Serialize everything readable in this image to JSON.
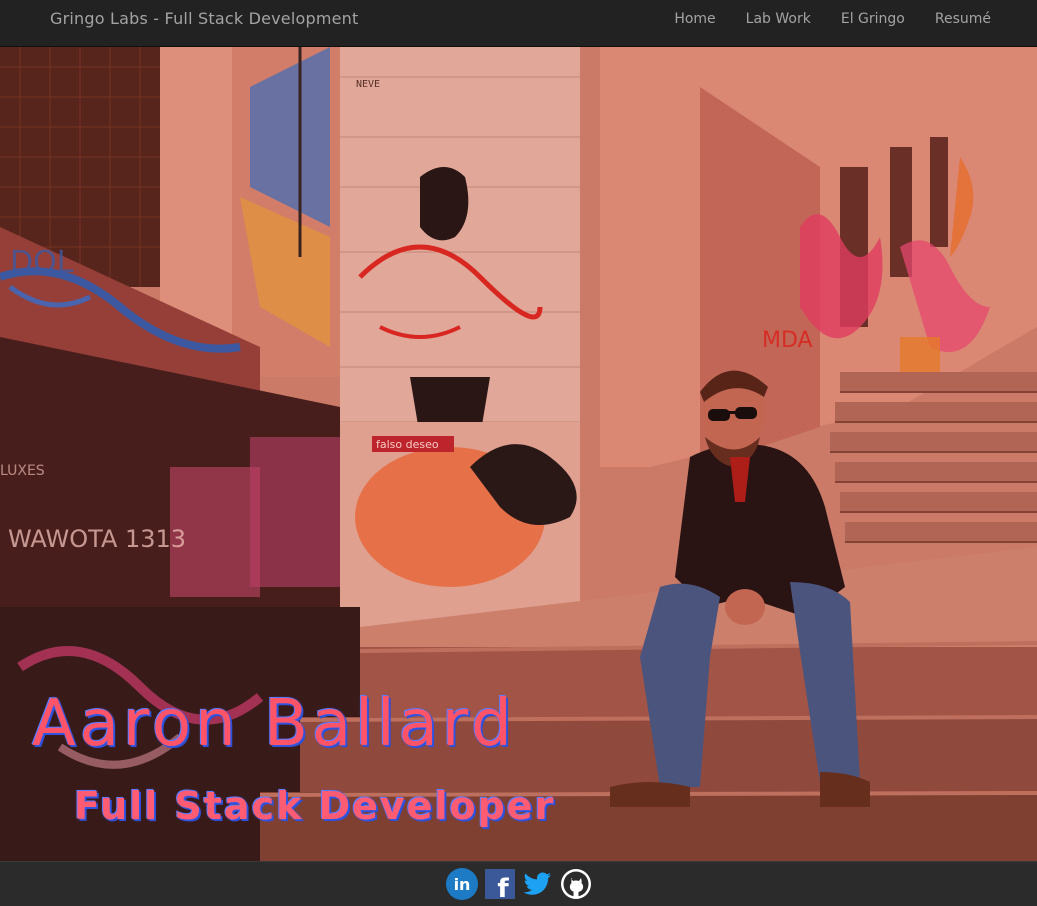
{
  "navbar": {
    "brand": "Gringo Labs - Full Stack Development",
    "links": [
      {
        "label": "Home"
      },
      {
        "label": "Lab Work"
      },
      {
        "label": "El Gringo"
      },
      {
        "label": "Resumé"
      }
    ]
  },
  "hero": {
    "name": "Aaron Ballard",
    "title": "Full Stack Developer",
    "wall_sign": "falso deseo",
    "graffiti_text": [
      "WAWOTA 1313",
      "LUXES",
      "MDA",
      "DOL"
    ]
  },
  "footer": {
    "social": [
      {
        "icon": "linkedin-icon",
        "label": "in",
        "color": "#1c7bc4"
      },
      {
        "icon": "facebook-icon",
        "label": "f",
        "color": "#3b5998"
      },
      {
        "icon": "twitter-icon",
        "color": "#1da1f2"
      },
      {
        "icon": "github-icon",
        "color": "#ffffff"
      }
    ]
  },
  "colors": {
    "navbar_bg": "#222222",
    "nav_text": "#a3a3a3",
    "hero_tint": "#e04230",
    "name_text": "#ff5368",
    "name_shadow": "#2f4fd6"
  }
}
